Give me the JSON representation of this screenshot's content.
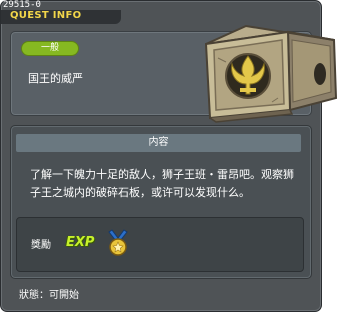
{
  "window": {
    "quest_id": "29515-0",
    "title": "QUEST INFO"
  },
  "info": {
    "category_badge": "一般",
    "quest_name": "国王的威严"
  },
  "content": {
    "header": "内容",
    "description": "了解一下魄力十足的敌人，狮子王班・雷昂吧。观察狮子王之城内的破碎石板，或许可以发现什么。"
  },
  "reward": {
    "label": "獎勵",
    "exp_label": "EXP"
  },
  "status": {
    "text": "狀態：可開始"
  },
  "colors": {
    "window_bg": "#4f5356",
    "title_text": "#f2d64a",
    "badge_green": "#86b821",
    "exp_green": "#c7f12b",
    "header_bar": "#6a7880"
  },
  "icons": {
    "quest_image": "stone-chest-icon",
    "reward_medal": "gold-medal-icon"
  }
}
